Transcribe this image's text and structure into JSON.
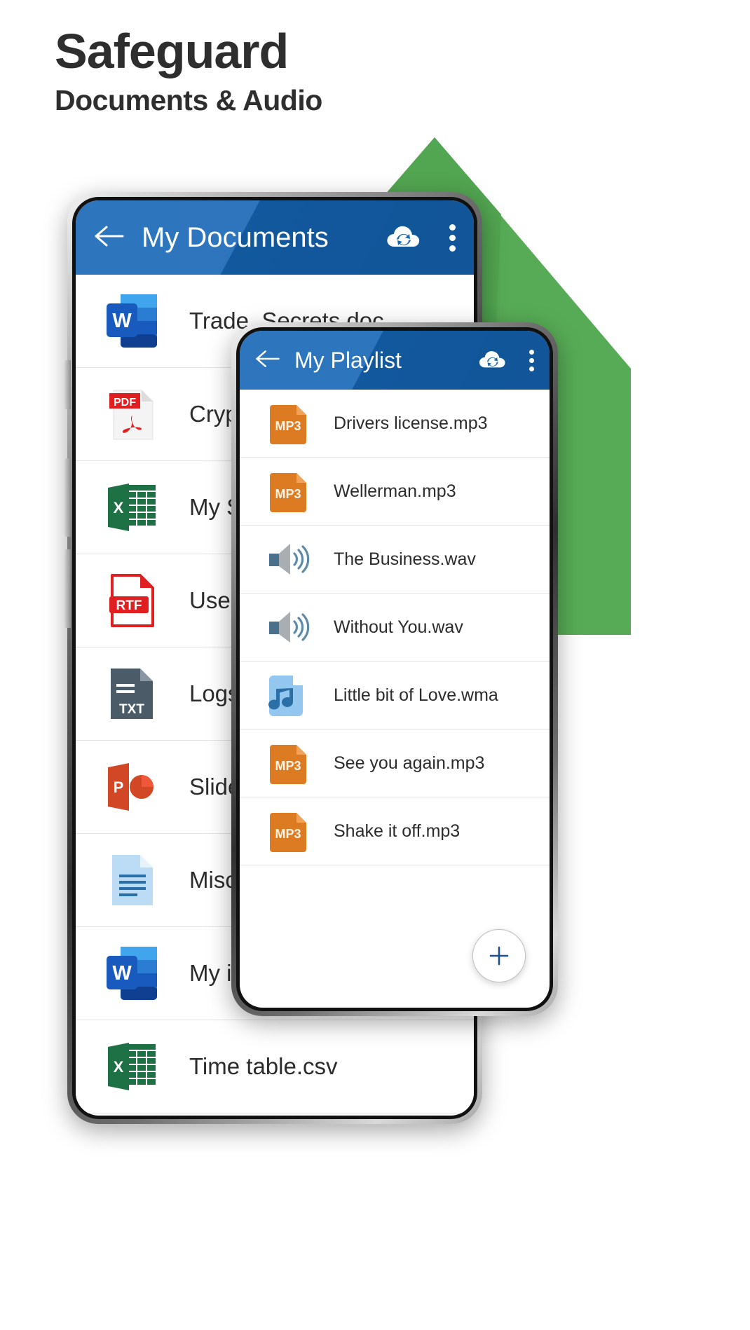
{
  "headline": {
    "title": "Safeguard",
    "subtitle": "Documents & Audio"
  },
  "colors": {
    "appbar_blue": "#1565b5",
    "green_shape": "#57ab56",
    "text_dark": "#2e2e2e",
    "mp3_orange": "#dd7b22",
    "wav_gray": "#a9aeb2",
    "wma_blue": "#93c7ef"
  },
  "phone1": {
    "appbar": {
      "back_label": "back-arrow",
      "title": "My Documents",
      "cloud_icon": "cloud-sync-icon",
      "menu_icon": "overflow-menu-icon"
    },
    "files": [
      {
        "name": "Trade_Secrets.doc",
        "icon": "word-icon"
      },
      {
        "name": "Crypto",
        "icon": "pdf-icon"
      },
      {
        "name": "My She",
        "icon": "excel-icon"
      },
      {
        "name": "User G",
        "icon": "rtf-icon"
      },
      {
        "name": "Logs.txt",
        "icon": "txt-icon"
      },
      {
        "name": "Slides.p",
        "icon": "powerpoint-icon"
      },
      {
        "name": "Misc.do",
        "icon": "document-icon"
      },
      {
        "name": "My idea",
        "icon": "word-icon"
      },
      {
        "name": "Time table.csv",
        "icon": "excel-icon"
      }
    ]
  },
  "phone2": {
    "appbar": {
      "back_label": "back-arrow",
      "title": "My Playlist",
      "cloud_icon": "cloud-sync-icon",
      "menu_icon": "overflow-menu-icon"
    },
    "files": [
      {
        "name": "Drivers license.mp3",
        "icon": "mp3-icon"
      },
      {
        "name": "Wellerman.mp3",
        "icon": "mp3-icon"
      },
      {
        "name": "The Business.wav",
        "icon": "speaker-icon"
      },
      {
        "name": "Without You.wav",
        "icon": "speaker-icon"
      },
      {
        "name": "Little bit of Love.wma",
        "icon": "music-note-icon"
      },
      {
        "name": "See you again.mp3",
        "icon": "mp3-icon"
      },
      {
        "name": "Shake it off.mp3",
        "icon": "mp3-icon"
      }
    ],
    "fab": {
      "label": "+",
      "name": "add-track-button"
    }
  }
}
